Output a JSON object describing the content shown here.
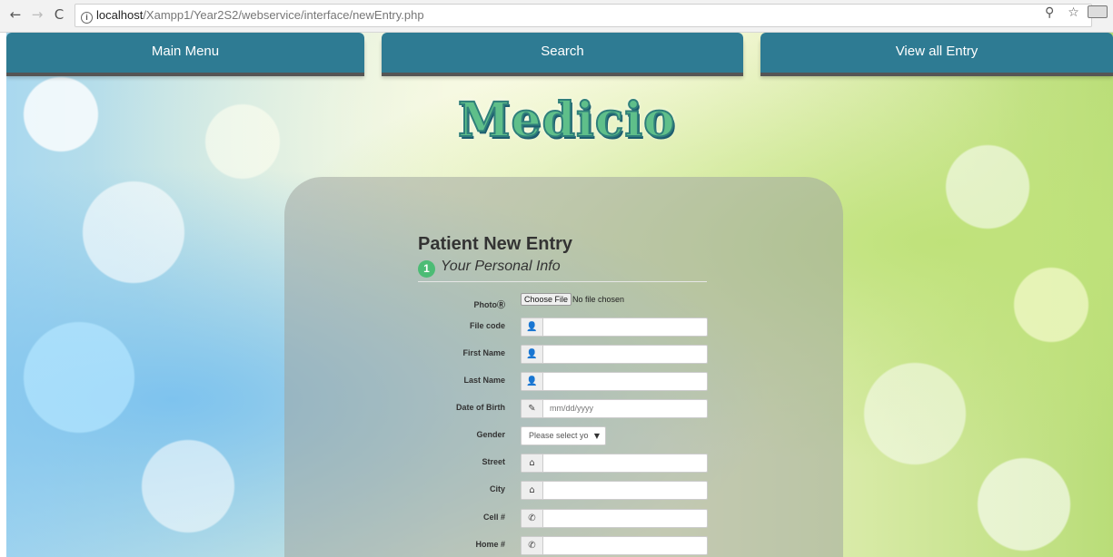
{
  "browser": {
    "url_host": "localhost",
    "url_path": "/Xampp1/Year2S2/webservice/interface/newEntry.php"
  },
  "nav": {
    "main_menu": "Main Menu",
    "search": "Search",
    "view_all": "View all Entry"
  },
  "logo": {
    "text": "Medicio"
  },
  "form": {
    "title": "Patient New Entry",
    "step": {
      "number": "1",
      "label": "Your Personal Info"
    },
    "photo": {
      "label": "PhotoⓇ",
      "button": "Choose File",
      "status": "No file chosen"
    },
    "file_code": {
      "label": "File code",
      "value": ""
    },
    "first_name": {
      "label": "First Name",
      "value": ""
    },
    "last_name": {
      "label": "Last Name",
      "value": ""
    },
    "dob": {
      "label": "Date of Birth",
      "placeholder": "mm/dd/yyyy"
    },
    "gender": {
      "label": "Gender",
      "selected": "Please select yo"
    },
    "street": {
      "label": "Street",
      "value": ""
    },
    "city": {
      "label": "City",
      "value": ""
    },
    "cell": {
      "label": "Cell #",
      "value": ""
    },
    "home": {
      "label": "Home #",
      "value": ""
    }
  },
  "colors": {
    "nav_bg": "#2e7b93",
    "step_badge": "#4cbc75"
  }
}
